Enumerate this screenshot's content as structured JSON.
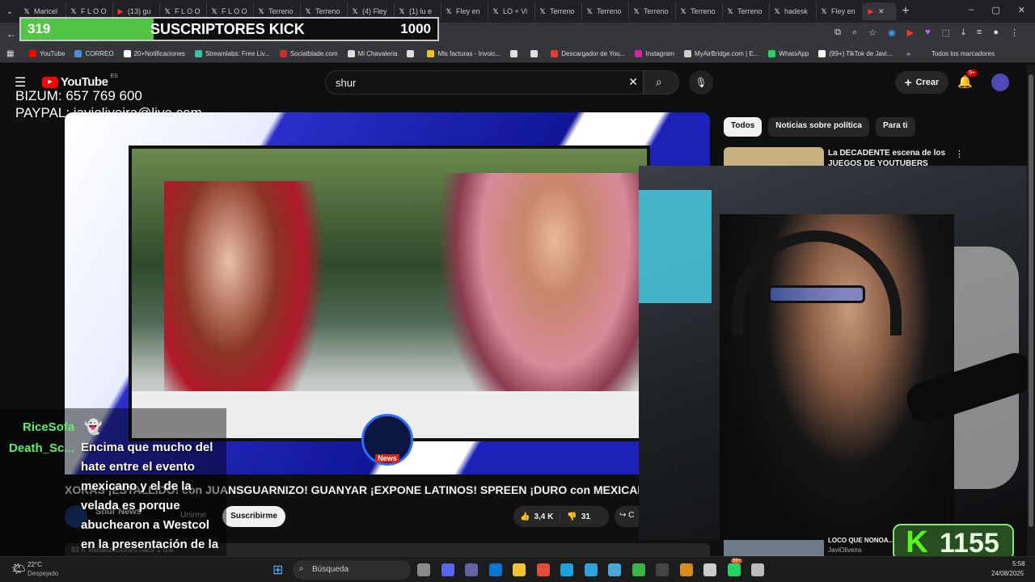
{
  "browser": {
    "tabs": [
      {
        "icon": "x-icon",
        "label": "Maricel"
      },
      {
        "icon": "x-icon",
        "label": "F L O O"
      },
      {
        "icon": "youtube-icon",
        "label": "(13) gu"
      },
      {
        "icon": "x-icon",
        "label": "F L O O"
      },
      {
        "icon": "x-icon",
        "label": "F L O O"
      },
      {
        "icon": "x-icon",
        "label": "Terreno"
      },
      {
        "icon": "x-icon",
        "label": "Terreno"
      },
      {
        "icon": "x-icon",
        "label": "(4) Fley"
      },
      {
        "icon": "x-icon",
        "label": "(1) lu e"
      },
      {
        "icon": "x-icon",
        "label": "Fley en"
      },
      {
        "icon": "x-icon",
        "label": "LO + Vi"
      },
      {
        "icon": "x-icon",
        "label": "Terreno"
      },
      {
        "icon": "x-icon",
        "label": "Terreno"
      },
      {
        "icon": "x-icon",
        "label": "Terreno"
      },
      {
        "icon": "x-icon",
        "label": "Terreno"
      },
      {
        "icon": "x-icon",
        "label": "Terreno"
      },
      {
        "icon": "x-icon",
        "label": "hadesk"
      },
      {
        "icon": "x-icon",
        "label": "Fley en"
      }
    ],
    "address_url": "watch?v=...&ab_channel=ShurNews",
    "bookmarks": [
      {
        "label": "YouTube",
        "color": "#ff0000"
      },
      {
        "label": "CORREO",
        "color": "#4a90d9"
      },
      {
        "label": "20+Notificaciones",
        "color": "#ffffff"
      },
      {
        "label": "Streamlabs: Free Liv...",
        "color": "#31c3a2"
      },
      {
        "label": "Socialblade.com",
        "color": "#cc2b2b"
      },
      {
        "label": "Mi Chavaleria",
        "color": "#dddddd"
      },
      {
        "label": "",
        "color": "#dddddd"
      },
      {
        "label": "Mis facturas - Invoic...",
        "color": "#f0c419"
      },
      {
        "label": "",
        "color": "#dddddd"
      },
      {
        "label": "",
        "color": "#dddddd"
      },
      {
        "label": "Descargador de You...",
        "color": "#e53935"
      },
      {
        "label": "Instagram",
        "color": "#d6249f"
      },
      {
        "label": "MyAirBridge.com | E...",
        "color": "#cccccc"
      },
      {
        "label": "WhatsApp",
        "color": "#25d366"
      },
      {
        "label": "(99+) TikTok de Javi...",
        "color": "#ffffff"
      }
    ],
    "bookmarks_overflow": "»",
    "all_bookmarks": "Todos los marcadores"
  },
  "youtube": {
    "logo_text": "YouTube",
    "region": "ES",
    "search_value": "shur",
    "create_label": "Crear",
    "notif_count": "9+",
    "chips": [
      "Todos",
      "Noticias sobre política",
      "Para ti"
    ],
    "sidebar_video_title": "La DECADENTE escena de los JUEGOS DE YOUTUBERS",
    "sidebar_video2_title": "LOCO QUE NONOA...",
    "sidebar_video2_channel": "JaviOliveira",
    "video_title": "XOKAS ¡ESTALLIDO! con JUANSGUARNIZO! GUANYAR ¡EXPONE LATINOS! SPREEN ¡DURO con MEXICANOS!",
    "channel": "Shur News",
    "join_label": "Unirme",
    "subscribe_label": "Suscribirme",
    "likes": "3,4 K",
    "dislikes": "31",
    "share_label": "C",
    "views": "83 K visualizaciones  hace 1 día",
    "watermark": "News"
  },
  "overlays": {
    "sub_current": "319",
    "sub_label": "SUSCRIPTORES KICK",
    "sub_goal": "1000",
    "sub_progress": 0.319,
    "bizum": "BIZUM: 657 769 600",
    "paypal": "PAYPAL: javioliveira@live.com",
    "kick_count": "1155",
    "kick_letter": "K"
  },
  "chat": {
    "names": [
      "RiceSofa",
      "Death_Sc..."
    ],
    "message": "Encima que mucho del hate entre el evento mexicano y el de la velada es porque abuchearon a Westcol en la presentación de la velada"
  },
  "taskbar": {
    "weather_temp": "22°C",
    "weather_desc": "Despejado",
    "search_placeholder": "Búsqueda",
    "time": "5:58",
    "date": "24/08/2025",
    "whatsapp_badge": "99+"
  },
  "colors": {
    "kick_green": "#53c546",
    "youtube_red": "#ff0000",
    "chat_name": "#5cf06c"
  }
}
